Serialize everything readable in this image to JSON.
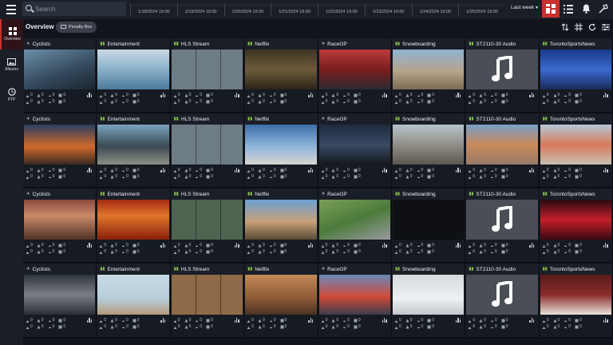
{
  "app": {
    "search_placeholder": "Search",
    "period": "Last week"
  },
  "timeline": [
    "1/18/2024 19:00",
    "1/19/2024 19:00",
    "1/20/2024 19:00",
    "1/21/2024 19:00",
    "1/22/2024 19:00",
    "1/23/2024 19:00",
    "1/24/2024 19:00",
    "1/25/2024 19:00"
  ],
  "sidebar": [
    {
      "label": "Overview",
      "icon": "grid-icon"
    },
    {
      "label": "Albums",
      "icon": "images-icon"
    },
    {
      "label": "PTP",
      "icon": "clock-icon"
    }
  ],
  "overview": {
    "title": "Overview",
    "chip": "Penalty Box"
  },
  "stats": {
    "values": [
      "0",
      "0",
      "0",
      "0",
      "0",
      "0",
      "0",
      "0"
    ]
  },
  "channels": [
    {
      "name": "Cyclists",
      "icon": "plane-icon"
    },
    {
      "name": "Entertainment",
      "icon": "signal-icon"
    },
    {
      "name": "HLS Stream",
      "icon": "signal-icon"
    },
    {
      "name": "Netflix",
      "icon": "signal-icon"
    },
    {
      "name": "RaceGP",
      "icon": "plane-icon"
    },
    {
      "name": "Snowboarding",
      "icon": "signal-icon"
    },
    {
      "name": "ST2110-30 Audio",
      "icon": "signal-icon"
    },
    {
      "name": "TorontoSportsNews",
      "icon": "signal-icon"
    }
  ]
}
